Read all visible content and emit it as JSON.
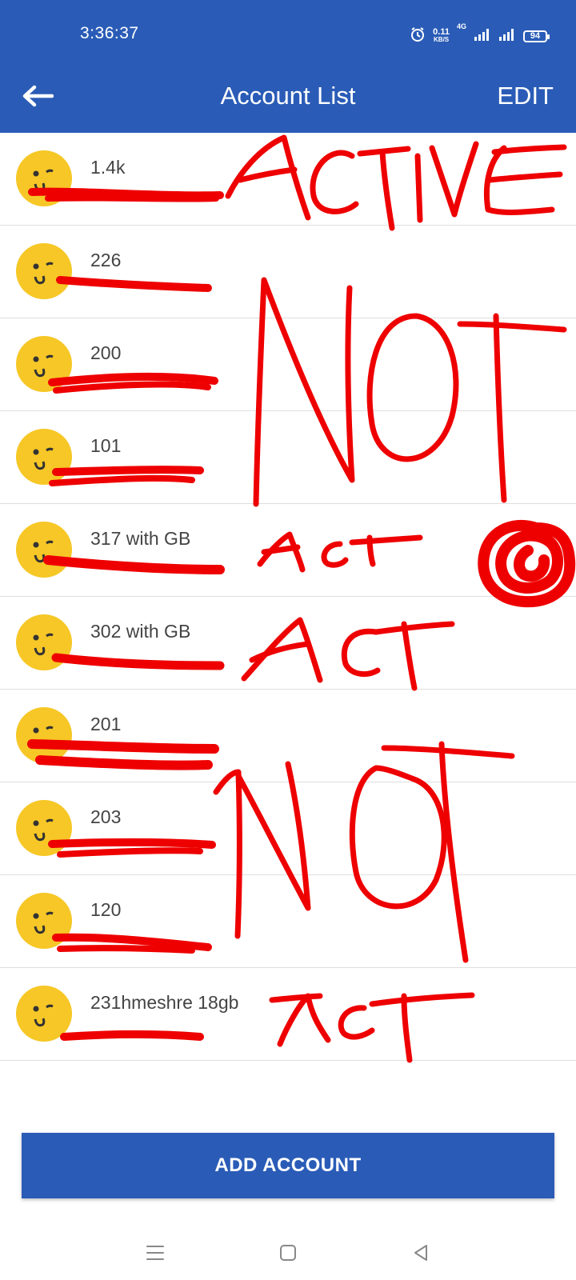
{
  "status_bar": {
    "time": "3:36:37",
    "net_speed_value": "0.11",
    "net_speed_unit": "KB/S",
    "net_type": "4G",
    "battery": "94",
    "icons": [
      "alarm-icon",
      "signal-icon",
      "signal-icon",
      "battery-icon"
    ]
  },
  "app_bar": {
    "title": "Account List",
    "edit_label": "EDIT",
    "back_icon": "arrow-left-icon"
  },
  "accounts": [
    {
      "name": "1.4k"
    },
    {
      "name": "226"
    },
    {
      "name": "200"
    },
    {
      "name": "101"
    },
    {
      "name": "317 with GB"
    },
    {
      "name": "302 with GB"
    },
    {
      "name": "201"
    },
    {
      "name": "203"
    },
    {
      "name": "120"
    },
    {
      "name": "231hmeshre 18gb"
    }
  ],
  "add_account_label": "ADD ACCOUNT",
  "colors": {
    "primary": "#2a5cb7",
    "avatar": "#f6c726",
    "scribble": "#ee0000"
  },
  "nav_icons": [
    "menu-icon",
    "home-square-icon",
    "back-triangle-icon"
  ]
}
